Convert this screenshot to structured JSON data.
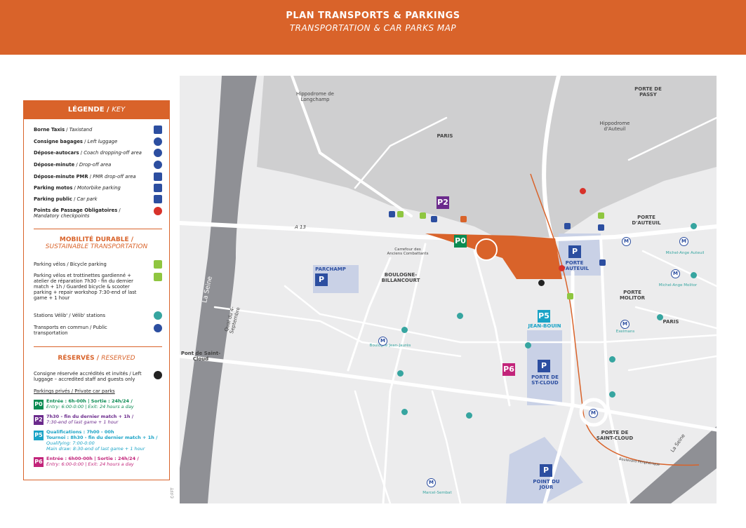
{
  "header": {
    "title": "PLAN TRANSPORTS & PARKINGS",
    "subtitle": "TRANSPORTATION & CAR PARKS MAP"
  },
  "legend": {
    "title": "LÉGENDE",
    "title_en": "KEY",
    "items": [
      {
        "fr": "Borne Taxis",
        "en": "Taxistand",
        "icon": "taxi-icon",
        "color": "#2c4ea0"
      },
      {
        "fr": "Consigne bagages",
        "en": "Left luggage",
        "icon": "luggage-icon",
        "color": "#2c4ea0"
      },
      {
        "fr": "Dépose-autocars",
        "en": "Coach dropping-off area",
        "icon": "coach-icon",
        "color": "#2c4ea0"
      },
      {
        "fr": "Dépose-minute",
        "en": "Drop-off area",
        "icon": "dropoff-icon",
        "color": "#2c4ea0"
      },
      {
        "fr": "Dépose-minute PMR",
        "en": "PMR drop-off area",
        "icon": "wheelchair-icon",
        "color": "#2c4ea0"
      },
      {
        "fr": "Parking motos",
        "en": "Motorbike parking",
        "icon": "motorbike-icon",
        "color": "#2c4ea0"
      },
      {
        "fr": "Parking public",
        "en": "Car park",
        "icon": "parking-icon",
        "color": "#2c4ea0"
      },
      {
        "fr": "Points de Passage Obligatoires",
        "en": "Mandatory checkpoints",
        "icon": "checkpoint-icon",
        "color": "#d8322a"
      }
    ],
    "mobility_title": "MOBILITÉ DURABLE",
    "mobility_title_en": "SUSTAINABLE TRANSPORTATION",
    "mobility_items": [
      {
        "text": "Parking vélos / Bicycle parking",
        "icon": "bicycle-icon",
        "color": "#8fc640"
      },
      {
        "text": "Parking vélos et trottinettes gardienné + atelier de réparation 7h30 - fin du dernier match + 1h / Guarded bicycle & scooter parking + repair workshop 7:30-end of last game + 1 hour",
        "icon": "guarded-bicycle-icon",
        "color": "#8fc640"
      },
      {
        "text": "Stations Vélib' / Vélib' stations",
        "icon": "velib-icon",
        "color": "#36a5a0"
      },
      {
        "text": "Transports en commun / Public transportation",
        "icon": "metro-bus-icon",
        "color": "#2c4ea0"
      }
    ],
    "reserved_title": "RÉSERVÉS",
    "reserved_title_en": "RESERVED",
    "reserved_consigne": "Consigne réservée accrédités et invités / Left luggage – accredited staff and guests only",
    "private_parkings_title": "Parkings privés / Private car parks",
    "private_parkings": [
      {
        "badge": "P0",
        "color": "#0a8b52",
        "line1": "Entrée : 6h-00h | Sortie : 24h/24 /",
        "line2": "Entry: 6:00-0:00 | Exit: 24 hours a day",
        "line3": "",
        "line4": ""
      },
      {
        "badge": "P2",
        "color": "#6b2a8c",
        "line1": "7h30 - fin du dernier match + 1h /",
        "line2": "7:30-end of last game + 1 hour",
        "line3": "",
        "line4": ""
      },
      {
        "badge": "P5",
        "color": "#1aa3c6",
        "line1": "Qualifications : 7h00 - 00h",
        "line2": "Tournoi : 8h30 - fin du dernier match + 1h /",
        "line3": "Qualifying: 7:00-0:00",
        "line4": "Main draw: 8:30-end of last game + 1 hour"
      },
      {
        "badge": "P6",
        "color": "#c2247a",
        "line1": "Entrée : 6h00-00h | Sortie : 24h/24 /",
        "line2": "Entry: 6:00-0:00 | Exit: 24 hours a day",
        "line3": "",
        "line4": ""
      }
    ]
  },
  "map": {
    "labels": {
      "hippodrome_longchamp": "Hippodrome de Longchamp",
      "paris_top": "PARIS",
      "porte_de_passy": "PORTE DE PASSY",
      "hippodrome_auteuil": "Hippodrome d'Auteuil",
      "a13": "A 13",
      "parchamp": "PARCHAMP",
      "boulogne": "BOULOGNE- BILLANCOURT",
      "carrefour": "Carrefour des Anciens Combattants",
      "la_seine": "La Seine",
      "quai": "Quai du 4-Septembre",
      "pont_st_cloud": "Pont de Saint-Cloud",
      "porte_auteuil_map": "PORTE D'AUTEUIL",
      "porte_auteuil_right": "PORTE D'AUTEUIL",
      "porte_molitor": "PORTE MOLITOR",
      "paris_right": "PARIS",
      "jean_bouin": "JEAN-BOUIN",
      "porte_st_cloud_park": "PORTE DE ST-CLOUD",
      "porte_st_cloud": "PORTE DE SAINT-CLOUD",
      "point_du_jour": "POINT DU JOUR",
      "michel_ange_auteuil": "Michel-Ange Auteuil",
      "michel_ange_molitor": "Michel-Ange Molitor",
      "exelmans": "Exelmans",
      "boulogne_jean_jaures": "Boulogne Jean-Jaurès",
      "marcel_sembat": "Marcel-Sembat",
      "la_seine_right": "La Seine",
      "boulevard_peripherique": "Boulevard Périphérique"
    },
    "parkings": {
      "p0": "P0",
      "p2": "P2",
      "p5": "P5",
      "p6": "P6",
      "public": "P"
    }
  },
  "copyright": "©FFT"
}
